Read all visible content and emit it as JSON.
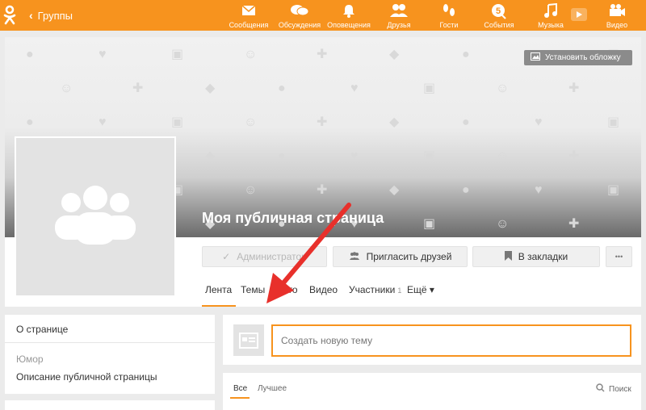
{
  "topbar": {
    "back_label": "Группы",
    "nav": [
      {
        "icon": "envelope-icon",
        "label": "Сообщения"
      },
      {
        "icon": "chat-icon",
        "label": "Обсуждения"
      },
      {
        "icon": "bell-icon",
        "label": "Оповещения"
      },
      {
        "icon": "friends-icon",
        "label": "Друзья"
      },
      {
        "icon": "footprints-icon",
        "label": "Гости"
      },
      {
        "icon": "coin-icon",
        "label": "События"
      },
      {
        "icon": "music-note-icon",
        "label": "Музыка"
      },
      {
        "icon": "video-camera-icon",
        "label": "Видео"
      }
    ],
    "color": "#f7931e"
  },
  "cover": {
    "set_cover_label": "Установить обложку",
    "title": "Моя публичная страница"
  },
  "actions": {
    "admin_label": "Администратор",
    "invite_label": "Пригласить друзей",
    "bookmark_label": "В закладки",
    "more_label": "•••"
  },
  "tabs": {
    "feed": "Лента",
    "topics": "Темы",
    "photo": "Фото",
    "video": "Видео",
    "members": "Участники",
    "members_count": "1",
    "more": "Ещё ▾"
  },
  "about": {
    "title": "О странице",
    "category": "Юмор",
    "description": "Описание публичной страницы"
  },
  "composer": {
    "placeholder": "Создать новую тему"
  },
  "feed": {
    "tab_all": "Все",
    "tab_best": "Лучшее",
    "search_label": "Поиск"
  }
}
